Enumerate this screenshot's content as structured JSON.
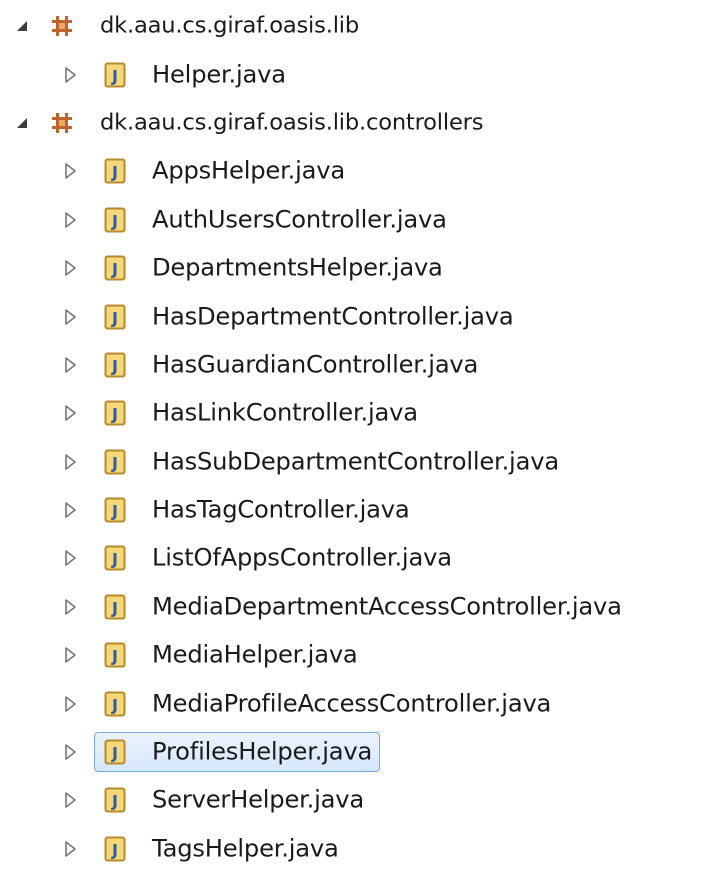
{
  "colors": {
    "package_icon": "#c0622e",
    "java_icon_border": "#b88a2b",
    "java_icon_fill": "#f5d877",
    "java_icon_letter": "#2a5db0",
    "toggle_arrow": "#777777",
    "selection_border": "#7aa7de"
  },
  "packages": [
    {
      "name": "dk.aau.cs.giraf.oasis.lib",
      "expanded": true,
      "icon": "package-icon",
      "files": [
        {
          "name": "Helper.java",
          "icon": "java-file-icon",
          "expanded": false
        }
      ]
    },
    {
      "name": "dk.aau.cs.giraf.oasis.lib.controllers",
      "expanded": true,
      "icon": "package-icon",
      "files": [
        {
          "name": "AppsHelper.java",
          "icon": "java-file-icon",
          "expanded": false
        },
        {
          "name": "AuthUsersController.java",
          "icon": "java-file-icon",
          "expanded": false
        },
        {
          "name": "DepartmentsHelper.java",
          "icon": "java-file-icon",
          "expanded": false
        },
        {
          "name": "HasDepartmentController.java",
          "icon": "java-file-icon",
          "expanded": false
        },
        {
          "name": "HasGuardianController.java",
          "icon": "java-file-icon",
          "expanded": false
        },
        {
          "name": "HasLinkController.java",
          "icon": "java-file-icon",
          "expanded": false
        },
        {
          "name": "HasSubDepartmentController.java",
          "icon": "java-file-icon",
          "expanded": false
        },
        {
          "name": "HasTagController.java",
          "icon": "java-file-icon",
          "expanded": false
        },
        {
          "name": "ListOfAppsController.java",
          "icon": "java-file-icon",
          "expanded": false
        },
        {
          "name": "MediaDepartmentAccessController.java",
          "icon": "java-file-icon",
          "expanded": false
        },
        {
          "name": "MediaHelper.java",
          "icon": "java-file-icon",
          "expanded": false
        },
        {
          "name": "MediaProfileAccessController.java",
          "icon": "java-file-icon",
          "expanded": false
        },
        {
          "name": "ProfilesHelper.java",
          "icon": "java-file-icon",
          "expanded": false,
          "selected": true
        },
        {
          "name": "ServerHelper.java",
          "icon": "java-file-icon",
          "expanded": false
        },
        {
          "name": "TagsHelper.java",
          "icon": "java-file-icon",
          "expanded": false
        }
      ]
    }
  ]
}
